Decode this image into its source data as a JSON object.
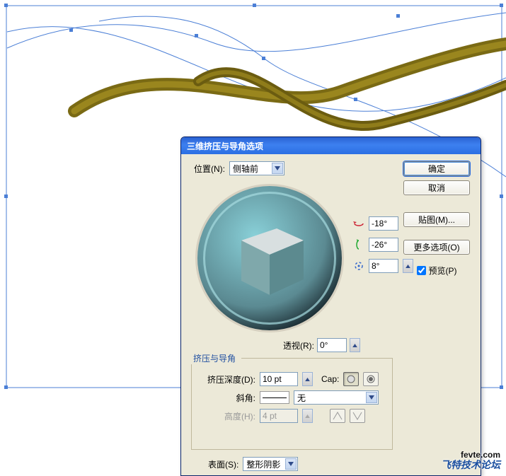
{
  "dialog": {
    "title": "三维挤压与导角选项",
    "position": {
      "label": "位置(N):",
      "value": "侧轴前"
    },
    "rotation": {
      "x": {
        "value": "-18°"
      },
      "y": {
        "value": "-26°"
      },
      "z": {
        "value": "8°"
      }
    },
    "perspective": {
      "label": "透视(R):",
      "value": "0°"
    },
    "extrude": {
      "legend": "挤压与导角",
      "depth": {
        "label": "挤压深度(D):",
        "value": "10 pt"
      },
      "cap": {
        "label": "Cap:"
      },
      "bevel": {
        "label": "斜角:",
        "value": "无"
      },
      "height": {
        "label": "高度(H):",
        "value": "4 pt"
      }
    },
    "surface": {
      "label": "表面(S):",
      "value": "整形阴影"
    },
    "buttons": {
      "ok": "确定",
      "cancel": "取消",
      "map": "贴图(M)...",
      "more": "更多选项(O)"
    },
    "preview": {
      "label": "预览(P)"
    }
  },
  "watermark": {
    "line1": "fevte.com",
    "line2": "飞特技术论坛"
  }
}
